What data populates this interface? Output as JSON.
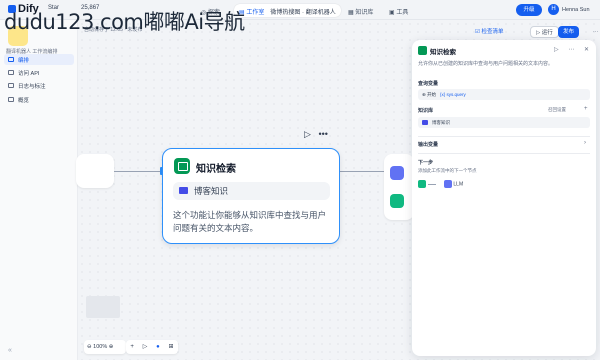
{
  "topbar": {
    "logo": "Dify",
    "star_label": "Star",
    "star_count": "25,867",
    "nav": {
      "explore": "探索",
      "studio": "工作室",
      "app_crumb": "微博热搜图 · 翻译机器人",
      "knowledge": "知识库",
      "tools": "工具"
    },
    "upgrade": "升级",
    "user": "Henna Sun"
  },
  "watermark": "dudu123.com嘟嘟Ai导航",
  "sidebar": {
    "app_name": "翻译机器人  工作流编排",
    "items": [
      {
        "label": "编排",
        "active": true
      },
      {
        "label": "访问 API",
        "active": false
      },
      {
        "label": "日志与标注",
        "active": false
      },
      {
        "label": "概览",
        "active": false
      }
    ],
    "collapse": "«"
  },
  "canvas": {
    "top_info": "自动保存于 12:05 · 未发布",
    "check": "检查清单",
    "run": "运行",
    "publish": "发布",
    "more": "⋯",
    "node": {
      "title": "知识检索",
      "kb": "博客知识",
      "description": "这个功能让你能够从知识库中查找与用户问题有关的文本内容。"
    },
    "node_actions": {
      "play": "▷",
      "more": "•••"
    },
    "zoom": "100%",
    "controls": [
      "+",
      "▷",
      "●",
      "⊞"
    ]
  },
  "panel": {
    "title": "知识检索",
    "header_actions": "▷ ⋯ ✕",
    "description": "允许你从已创建的知识库中查询与用户问题相关的文本内容。",
    "query_label": "查询变量",
    "query_value": "开始",
    "query_var": "{x} sys.query",
    "kb_label": "知识库",
    "kb_settings": "召回设置",
    "kb_add": "+",
    "kb_item": "博客知识",
    "output_label": "输出变量",
    "output_chevron": "›",
    "next_label": "下一步",
    "next_desc": "添加此工作流中的下一个节点",
    "next_node": "LLM"
  }
}
